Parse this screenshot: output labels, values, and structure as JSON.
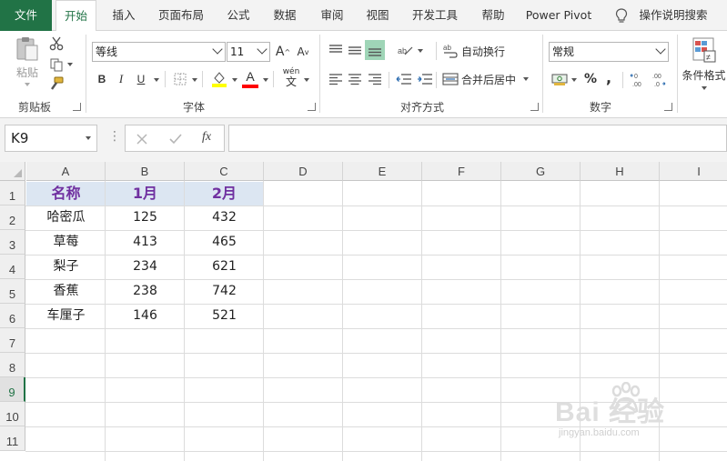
{
  "menu": {
    "file": "文件",
    "tabs": [
      "开始",
      "插入",
      "页面布局",
      "公式",
      "数据",
      "审阅",
      "视图",
      "开发工具",
      "帮助",
      "Power Pivot"
    ],
    "search": "操作说明搜索"
  },
  "ribbon": {
    "clipboard": {
      "paste": "粘贴",
      "label": "剪贴板"
    },
    "font": {
      "name": "等线",
      "size": "11",
      "bold": "B",
      "italic": "I",
      "underline": "U",
      "font_color_glyph": "A",
      "pinyin": "wén",
      "label": "字体"
    },
    "alignment": {
      "wrap": "自动换行",
      "merge": "合并后居中",
      "label": "对齐方式"
    },
    "number": {
      "format": "常规",
      "percent": "%",
      "comma": ",",
      "inc_dec": ".00",
      "label": "数字"
    },
    "styles": {
      "conditional": "条件格式"
    }
  },
  "formula_bar": {
    "name_box": "K9",
    "fx": "fx",
    "value": ""
  },
  "sheet": {
    "columns": [
      "A",
      "B",
      "C",
      "D",
      "E",
      "F",
      "G",
      "H",
      "I"
    ],
    "rows": [
      "1",
      "2",
      "3",
      "4",
      "5",
      "6",
      "7",
      "8",
      "9",
      "10",
      "11"
    ],
    "selected_row": "9",
    "header": [
      "名称",
      "1月",
      "2月"
    ],
    "data": [
      [
        "哈密瓜",
        "125",
        "432"
      ],
      [
        "草莓",
        "413",
        "465"
      ],
      [
        "梨子",
        "234",
        "621"
      ],
      [
        "香蕉",
        "238",
        "742"
      ],
      [
        "车厘子",
        "146",
        "521"
      ]
    ]
  },
  "watermark": {
    "big": "Bai 经验",
    "small": "jingyan.baidu.com"
  },
  "colors": {
    "excel_green": "#217346",
    "header_fill": "#dce6f2",
    "header_text": "#7030a0"
  }
}
